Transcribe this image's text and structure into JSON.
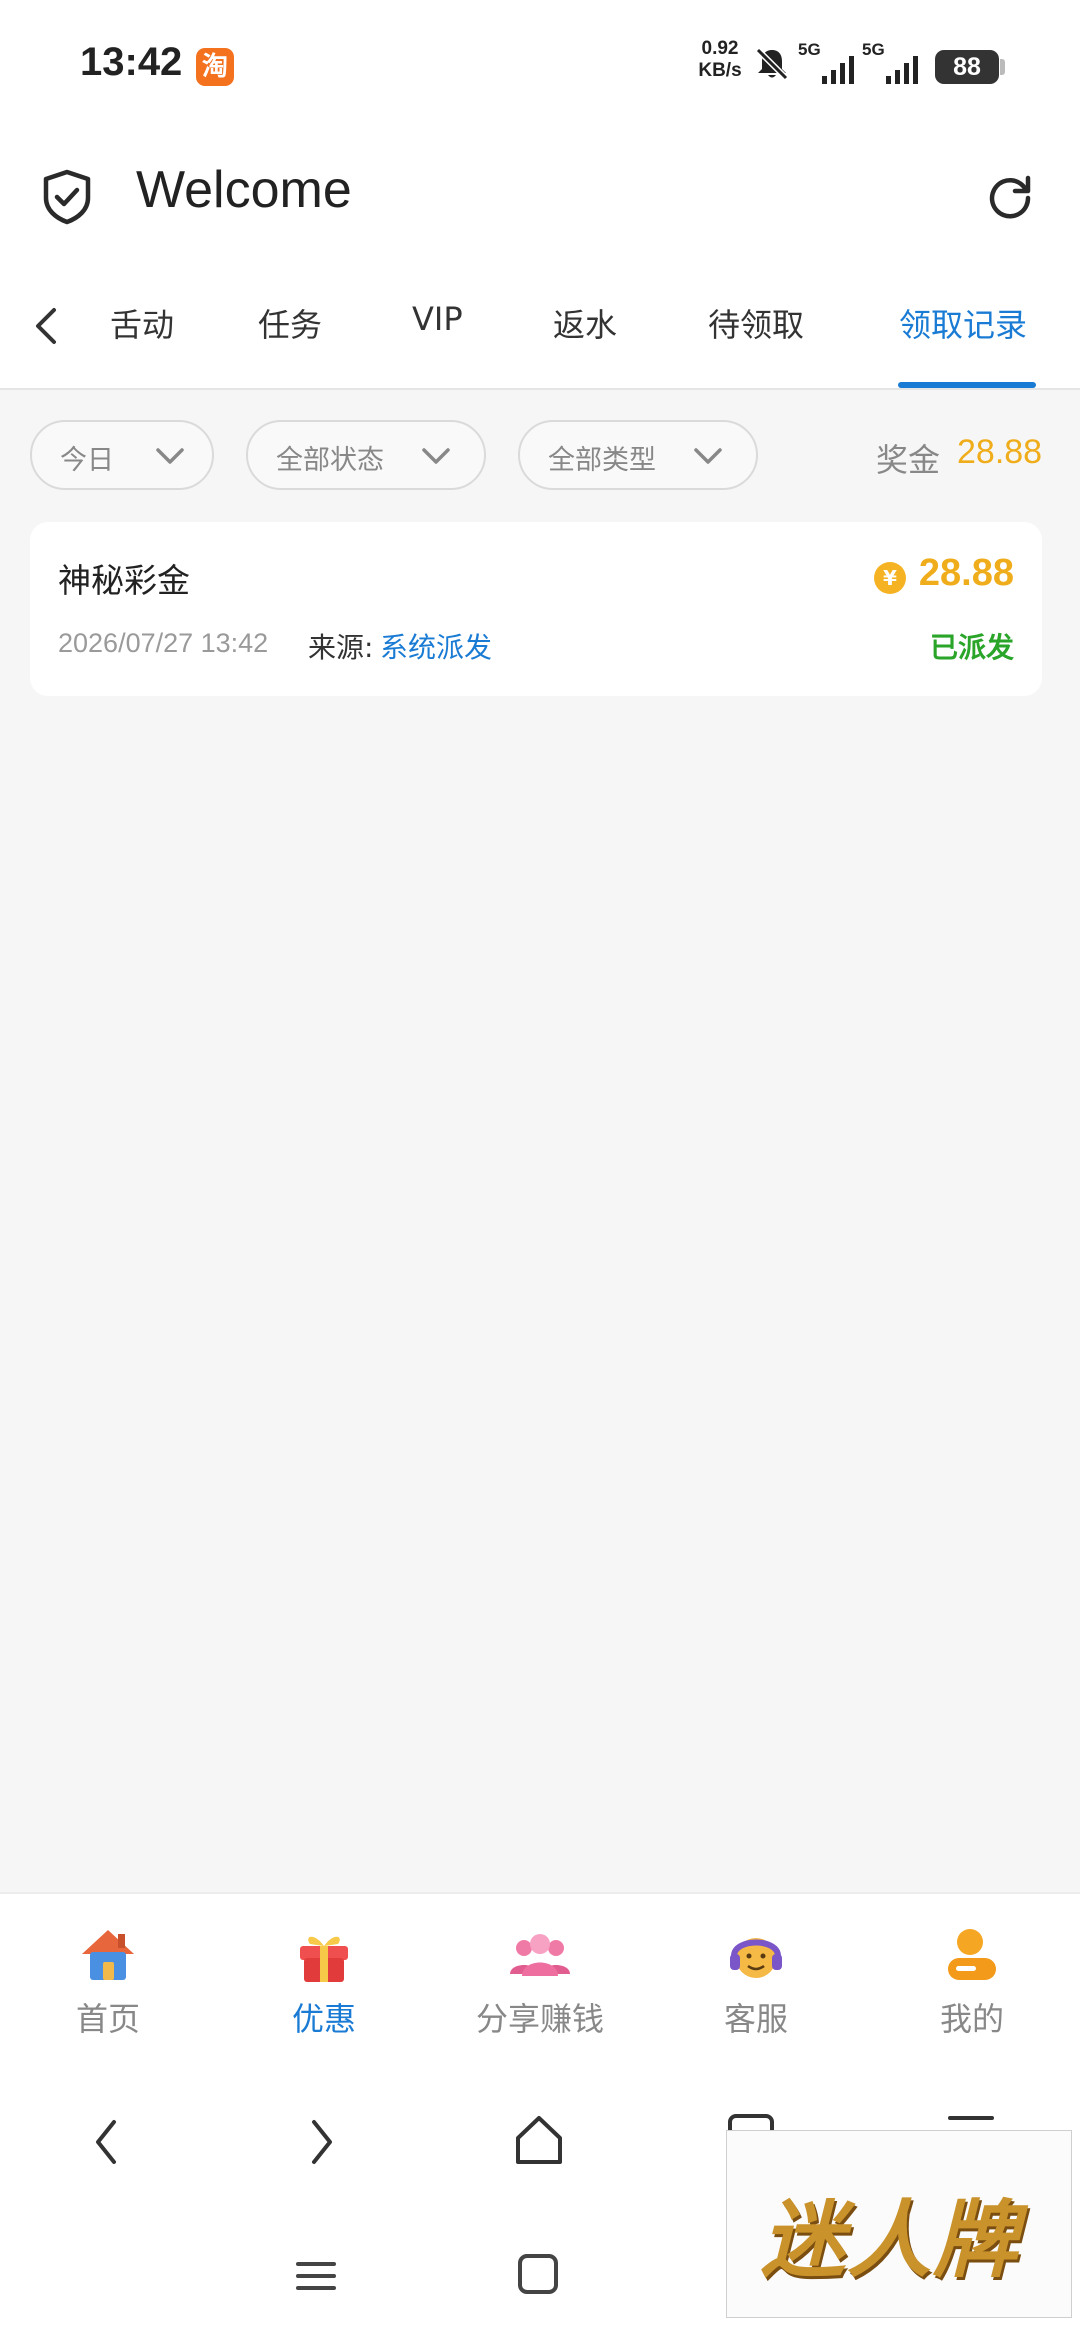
{
  "status_bar": {
    "time": "13:42",
    "app_badge": "淘",
    "net_speed_value": "0.92",
    "net_speed_unit": "KB/s",
    "sim1_label": "5G",
    "sim2_label": "5G",
    "battery": "88"
  },
  "header": {
    "title": "Welcome"
  },
  "tabs": {
    "items": [
      "舌动",
      "任务",
      "VIP",
      "返水",
      "待领取",
      "领取记录"
    ],
    "active_index": 5
  },
  "filters": {
    "date": "今日",
    "status": "全部状态",
    "type": "全部类型",
    "bonus_label": "奖金",
    "bonus_value": "28.88"
  },
  "records": [
    {
      "title": "神秘彩金",
      "amount": "28.88",
      "coin_symbol": "¥",
      "time": "2026/07/27 13:42",
      "source_label": "来源:",
      "source": "系统派发",
      "status": "已派发"
    }
  ],
  "bottom_nav": {
    "items": [
      "首页",
      "优惠",
      "分享赚钱",
      "客服",
      "我的"
    ],
    "active_index": 1
  },
  "watermark": {
    "text": "迷人牌"
  },
  "colors": {
    "accent": "#1a7bd4",
    "gold": "#f0ad1b",
    "success": "#2aa52a"
  }
}
